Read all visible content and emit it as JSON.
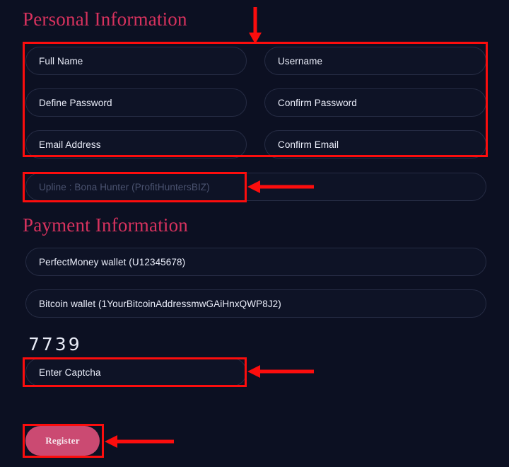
{
  "theme": {
    "background": "#0c1022",
    "heading_color": "#d7325e",
    "field_background": "#0e1326",
    "field_border": "#262c44",
    "text_color": "#eceffb",
    "muted_text_color": "#4b5370",
    "annotation_color": "#fc0d0d",
    "button_color": "#cb4a72",
    "button_text_color": "#f6e9ef"
  },
  "personal_information": {
    "heading": "Personal Information",
    "fields": [
      {
        "name": "full-name",
        "placeholder": "Full Name"
      },
      {
        "name": "username",
        "placeholder": "Username"
      },
      {
        "name": "define-password",
        "placeholder": "Define Password"
      },
      {
        "name": "confirm-password",
        "placeholder": "Confirm Password"
      },
      {
        "name": "email-address",
        "placeholder": "Email Address"
      },
      {
        "name": "confirm-email",
        "placeholder": "Confirm Email"
      }
    ],
    "upline": {
      "name": "upline",
      "value": "Upline : Bona Hunter (ProfitHuntersBIZ)"
    }
  },
  "payment_information": {
    "heading": "Payment Information",
    "fields": [
      {
        "name": "perfectmoney-wallet",
        "placeholder": "PerfectMoney wallet (U12345678)"
      },
      {
        "name": "bitcoin-wallet",
        "placeholder": "Bitcoin wallet (1YourBitcoinAddressmwGAiHnxQWP8J2)"
      }
    ]
  },
  "captcha": {
    "code": "7739",
    "input_placeholder": "Enter Captcha"
  },
  "actions": {
    "register_label": "Register"
  },
  "annotations": {
    "boxes": [
      {
        "name": "annotation-box-personal-fields"
      },
      {
        "name": "annotation-box-upline"
      },
      {
        "name": "annotation-box-captcha"
      },
      {
        "name": "annotation-box-register"
      }
    ],
    "arrows": [
      {
        "name": "arrow-down-to-personal-fields",
        "direction": "down"
      },
      {
        "name": "arrow-left-to-upline",
        "direction": "left"
      },
      {
        "name": "arrow-left-to-captcha",
        "direction": "left"
      },
      {
        "name": "arrow-left-to-register",
        "direction": "left"
      }
    ]
  }
}
